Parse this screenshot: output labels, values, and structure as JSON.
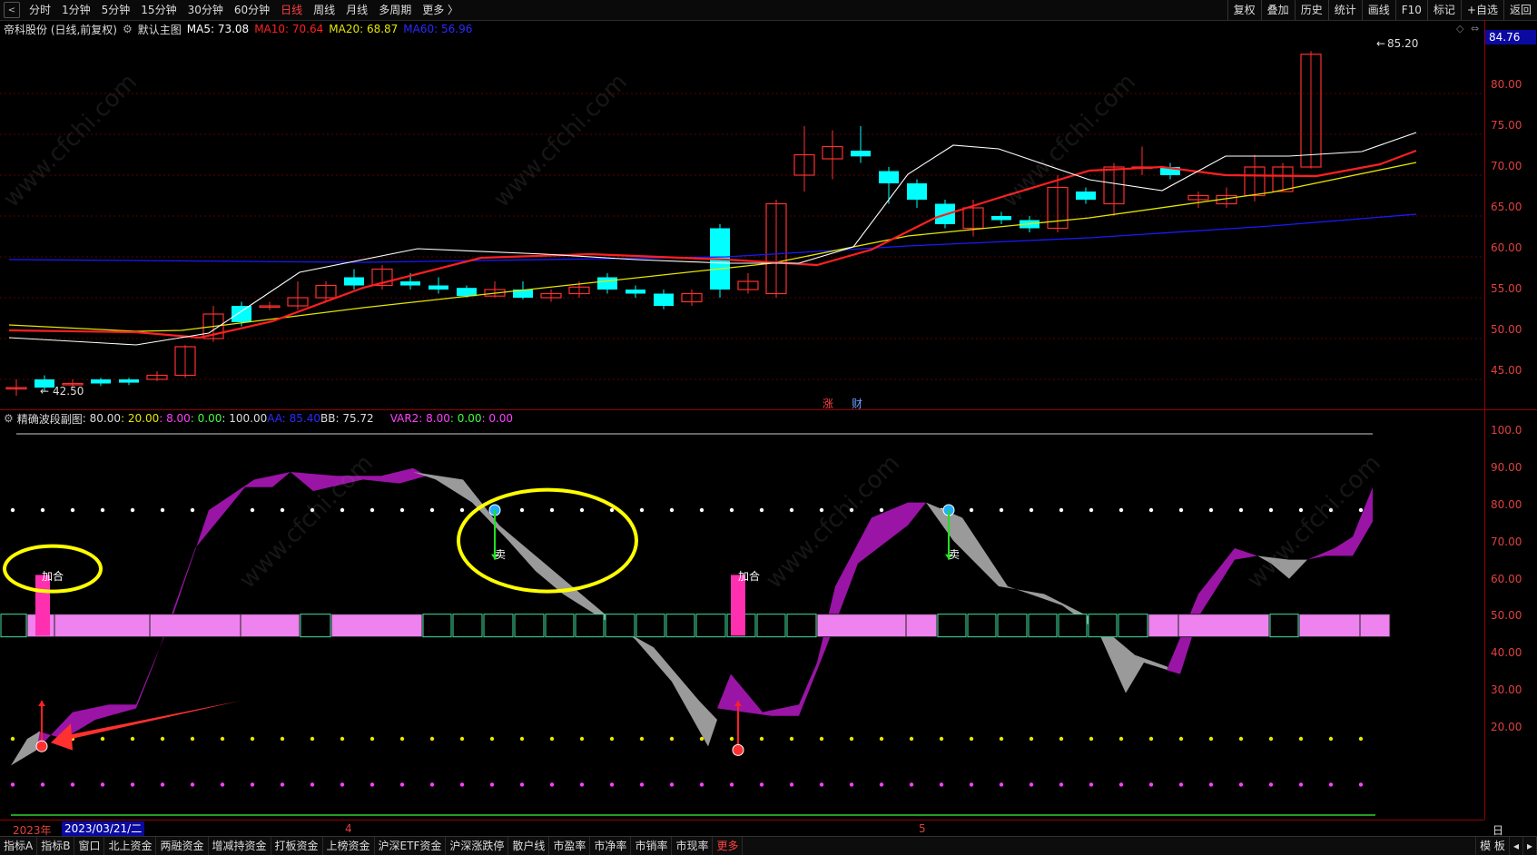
{
  "toolbar": {
    "left": [
      "分时",
      "1分钟",
      "5分钟",
      "15分钟",
      "30分钟",
      "60分钟",
      "日线",
      "周线",
      "月线",
      "多周期",
      "更多 〉"
    ],
    "active": "日线",
    "right": [
      "复权",
      "叠加",
      "历史",
      "统计",
      "画线",
      "F10",
      "标记",
      "+自选",
      "返回"
    ]
  },
  "main_legend": {
    "stock": "帝科股份 (日线,前复权)",
    "chart_name": "默认主图",
    "ma5": "MA5: 73.08",
    "ma10": "MA10: 70.64",
    "ma20": "MA20: 68.87",
    "ma60": "MA60: 56.96"
  },
  "colors": {
    "ma5": "#ffffff",
    "ma10": "#ff2020",
    "ma20": "#e6e600",
    "ma60": "#1a1aff",
    "up": "#ff3030",
    "down": "#00ffff",
    "axis": "#e04040"
  },
  "price_axis": {
    "current_price_tag": "84.76",
    "ticks": [
      "80.00",
      "75.00",
      "70.00",
      "65.00",
      "60.00",
      "55.00",
      "50.00",
      "45.00"
    ],
    "high_label": "85.20",
    "low_label": "42.50"
  },
  "event_marks": [
    "涨",
    "财"
  ],
  "sub_legend": {
    "name": "精确波段副图",
    "v1": ": 80.00",
    "v2": ": 20.00",
    "v3": ": 8.00",
    "v4": ": 0.00",
    "v5": ": 100.00",
    "aa": "AA: 85.40",
    "bb": "BB: 75.72",
    "var2": "VAR2: 8.00",
    "v6": ": 0.00",
    "v7": ": 0.00"
  },
  "sub_axis": {
    "ticks": [
      "100.0",
      "90.00",
      "80.00",
      "70.00",
      "60.00",
      "50.00",
      "40.00",
      "30.00",
      "20.00"
    ]
  },
  "sub_labels": {
    "add_position": "加合",
    "sell": "卖"
  },
  "date_axis": {
    "year": "2023年",
    "cursor_date": "2023/03/21/二",
    "month4": "4",
    "month5": "5",
    "period": "日线"
  },
  "bottom_tabs": [
    "指标A",
    "指标B",
    "窗口",
    "北上资金",
    "两融资金",
    "增减持资金",
    "打板资金",
    "上榜资金",
    "沪深ETF资金",
    "沪深涨跌停",
    "散户线",
    "市盈率",
    "市净率",
    "市销率",
    "市现率",
    "更多"
  ],
  "bottom_right": "模 板",
  "watermark_text": "www.cfchi.com"
}
